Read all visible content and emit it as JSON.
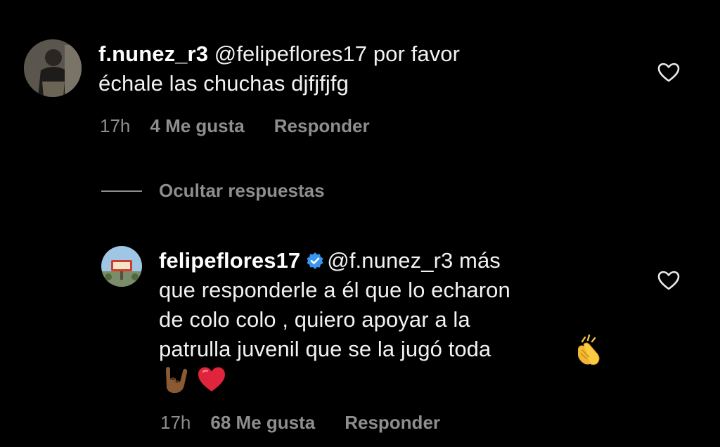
{
  "comments": [
    {
      "username": "f.nunez_r3",
      "text": " @felipeflores17 por favor",
      "text_line2": "échale las chuchas djfjfjfg",
      "time": "17h",
      "likes": "4 Me gusta",
      "reply": "Responder"
    },
    {
      "username": "felipeflores17",
      "verified": true,
      "text": "@f.nunez_r3 más",
      "lines": [
        "que responderle a él que lo echaron",
        "de colo colo , quiero apoyar a la",
        "patrulla juvenil que se la jugó toda"
      ],
      "time": "17h",
      "likes": "68 Me gusta",
      "reply": "Responder"
    }
  ],
  "hide_replies": "Ocultar respuestas",
  "icons": {
    "like": "heart-outline-icon",
    "verified": "verified-badge-icon",
    "clap": "clapping-hands-emoji",
    "rock": "sign-of-horns-emoji",
    "red_heart": "red-heart-emoji"
  },
  "colors": {
    "background": "#000000",
    "secondary_text": "#8e8e8e",
    "verified_blue": "#3897f0",
    "heart_red": "#e0243b"
  }
}
